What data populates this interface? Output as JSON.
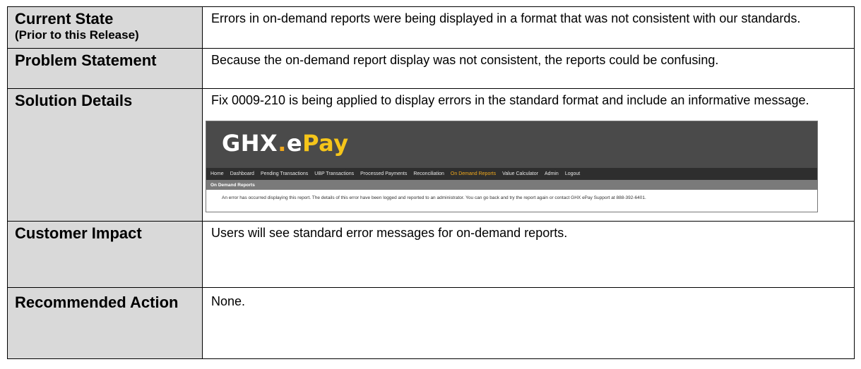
{
  "rows": [
    {
      "label": "Current State",
      "sublabel": "(Prior to this Release)",
      "value": "Errors in on-demand reports were being displayed in a format that was not consistent with our standards."
    },
    {
      "label": "Problem Statement",
      "value": "Because the on-demand report display was not consistent, the reports could be confusing."
    },
    {
      "label": "Solution Details",
      "value": "Fix 0009-210 is being applied to display errors in the standard format and include an informative message."
    },
    {
      "label": "Customer Impact",
      "value": "Users will see standard error messages for on-demand reports."
    },
    {
      "label": "Recommended Action",
      "value": "None."
    }
  ],
  "screenshot": {
    "logo_ghx": "GHX",
    "logo_dot": ".",
    "logo_e": "e",
    "logo_pay": "Pay",
    "nav": [
      "Home",
      "Dashboard",
      "Pending Transactions",
      "UBP Transactions",
      "Processed Payments",
      "Reconciliation",
      "On Demand Reports",
      "Value Calculator",
      "Admin",
      "Logout"
    ],
    "active_nav": "On Demand Reports",
    "breadcrumb": "On Demand Reports",
    "error_message": "An error has occurred displaying this report. The details of this error have been logged and reported to an administrator. You can go back and try the report again or contact GHX ePay Support at 888-392-6401."
  },
  "colors": {
    "label_bg": "#d9d9d9",
    "accent": "#f0a81c"
  }
}
